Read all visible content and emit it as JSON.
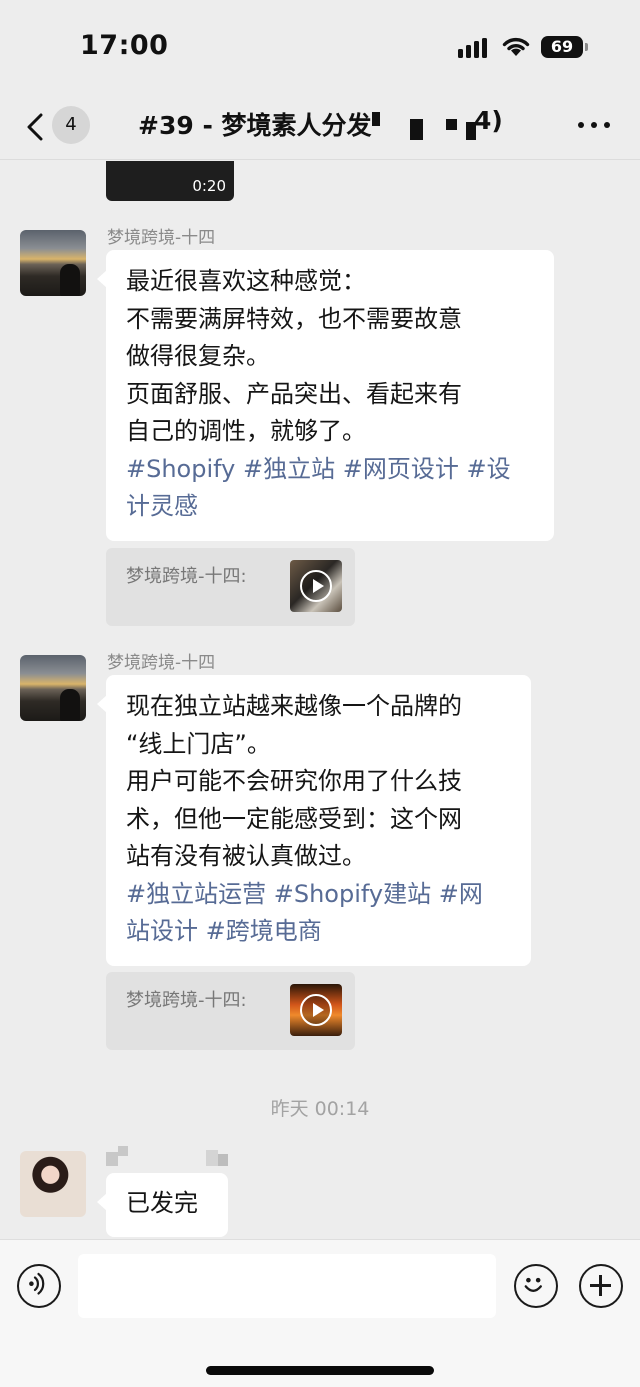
{
  "status_bar": {
    "time": "17:00",
    "battery": "69",
    "icons": [
      "signal-icon",
      "wifi-icon",
      "battery-icon"
    ]
  },
  "nav": {
    "back_icon": "chevron-left-icon",
    "unread_count": "4",
    "title": "#39 - 梦境素人分发",
    "title_tail": "4)",
    "more_icon": "ellipsis-icon"
  },
  "chat": {
    "top_video": {
      "duration": "0:20",
      "icon": "video-thumbnail"
    },
    "messages": [
      {
        "sender": "梦境跨境-十四",
        "avatar": "sunset-avatar",
        "lines": [
          "最近很喜欢这种感觉：",
          "不需要满屏特效，也不需要故意",
          "做得很复杂。",
          "页面舒服、产品突出、看起来有",
          "自己的调性，就够了。"
        ],
        "tag_lines": [
          "#Shopify #独立站 #网页设计 #设",
          "计灵感"
        ],
        "quote": {
          "sender": "梦境跨境-十四:",
          "icon": "play-icon"
        }
      },
      {
        "sender": "梦境跨境-十四",
        "avatar": "sunset-avatar",
        "lines": [
          "现在独立站越来越像一个品牌的",
          "“线上门店”。",
          "用户可能不会研究你用了什么技",
          "术，但他一定能感受到：这个网",
          "站有没有被认真做过。"
        ],
        "tag_lines": [
          "#独立站运营 #Shopify建站 #网",
          "站设计 #跨境电商"
        ],
        "quote": {
          "sender": "梦境跨境-十四:",
          "icon": "play-icon"
        }
      }
    ],
    "timestamp": "昨天 00:14",
    "last_message": {
      "avatar": "girl-avatar",
      "text": "已发完"
    }
  },
  "input_bar": {
    "voice_icon": "voice-icon",
    "placeholder": "",
    "emoji_icon": "emoji-icon",
    "plus_icon": "plus-icon"
  },
  "colors": {
    "background": "#ededed",
    "bubble": "#ffffff",
    "hashtag": "#576b95",
    "quote_bg": "#e1e1e1",
    "meta_text": "#8a8a8a"
  }
}
